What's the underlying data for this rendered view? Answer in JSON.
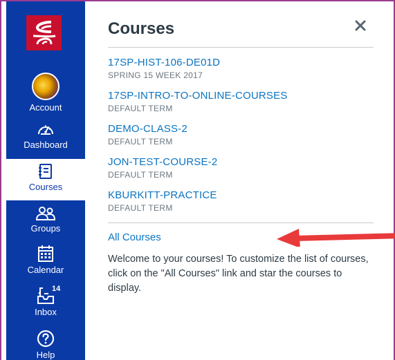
{
  "global_nav": {
    "items": [
      {
        "key": "account",
        "label": "Account",
        "icon": "avatar"
      },
      {
        "key": "dashboard",
        "label": "Dashboard",
        "icon": "dashboard-icon"
      },
      {
        "key": "courses",
        "label": "Courses",
        "icon": "courses-icon",
        "active": true
      },
      {
        "key": "groups",
        "label": "Groups",
        "icon": "groups-icon"
      },
      {
        "key": "calendar",
        "label": "Calendar",
        "icon": "calendar-icon"
      },
      {
        "key": "inbox",
        "label": "Inbox",
        "icon": "inbox-icon",
        "badge": "14"
      },
      {
        "key": "help",
        "label": "Help",
        "icon": "help-icon"
      }
    ]
  },
  "tray": {
    "title": "Courses",
    "courses": [
      {
        "name": "17SP-HIST-106-DE01D",
        "term": "SPRING 15 WEEK 2017"
      },
      {
        "name": "17SP-INTRO-TO-ONLINE-COURSES",
        "term": "DEFAULT TERM"
      },
      {
        "name": "DEMO-CLASS-2",
        "term": "DEFAULT TERM"
      },
      {
        "name": "JON-TEST-COURSE-2",
        "term": "DEFAULT TERM"
      },
      {
        "name": "KBURKITT-PRACTICE",
        "term": "DEFAULT TERM"
      }
    ],
    "all_courses_label": "All Courses",
    "help_text": "Welcome to your courses! To customize the list of courses, click on the \"All Courses\" link and star the courses to display."
  },
  "colors": {
    "nav_background": "#0a3aa6",
    "link": "#0b74c2",
    "logo": "#c8102e",
    "annotation_arrow": "#e83a3a",
    "frame": "#9b3b8e"
  }
}
